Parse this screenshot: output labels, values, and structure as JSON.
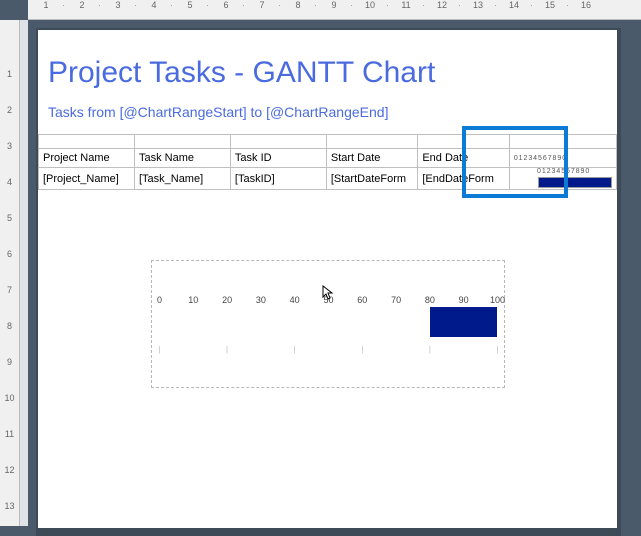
{
  "ruler": {
    "h": [
      "1",
      "2",
      "3",
      "4",
      "5",
      "6",
      "7",
      "8",
      "9",
      "10",
      "11",
      "12",
      "13",
      "14",
      "15",
      "16"
    ],
    "v": [
      "",
      "1",
      "2",
      "3",
      "4",
      "5",
      "6",
      "7",
      "8",
      "9",
      "10",
      "11",
      "12",
      "13"
    ]
  },
  "report": {
    "title": "Project Tasks - GANTT Chart",
    "subtitle": "Tasks from [@ChartRangeStart] to [@ChartRangeEnd]"
  },
  "columns": {
    "project": "Project Name",
    "task": "Task Name",
    "taskid": "Task ID",
    "start": "Start Date",
    "end": "End Date",
    "mini_axis": "0 1 2 3 4 5 6 7 8 9 0"
  },
  "row": {
    "project": "[Project_Name]",
    "task": "[Task_Name]",
    "taskid": "[TaskID]",
    "start": "[StartDateForm",
    "end": "[EndDateForm",
    "mini_axis": "0 1 2 3 4 5 6 7 8 9 0"
  },
  "chart_data": {
    "type": "bar",
    "x_ticks": [
      0,
      10,
      20,
      30,
      40,
      50,
      60,
      70,
      80,
      90,
      100
    ],
    "bars": [
      {
        "start": 80,
        "end": 100
      }
    ],
    "xlim": [
      0,
      100
    ]
  },
  "colors": {
    "accent": "#4a6bdf",
    "bar": "#001a8c",
    "highlight": "#0b7bd6",
    "handle": "#f59b00"
  }
}
